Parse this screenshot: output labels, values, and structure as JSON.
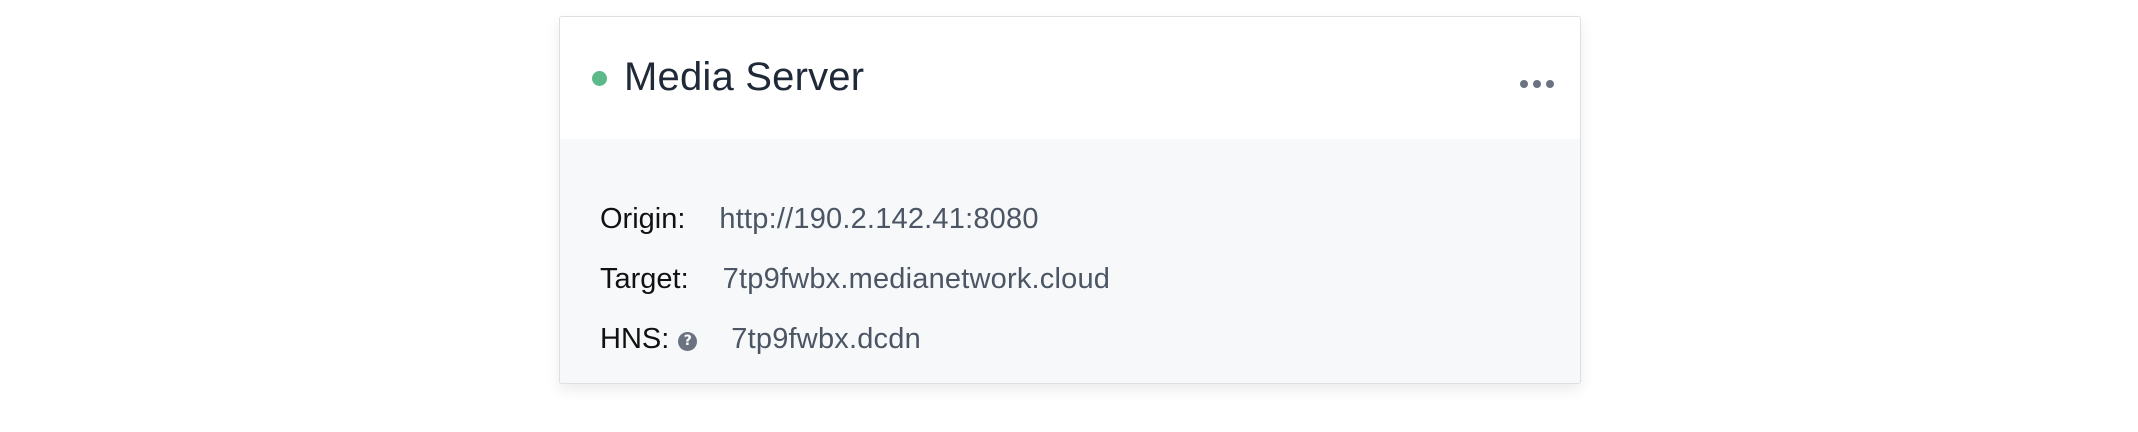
{
  "card": {
    "title": "Media Server",
    "status_color": "#5cb98a",
    "menu_icon": "ellipsis-icon"
  },
  "details": {
    "origin": {
      "label": "Origin:",
      "value": "http://190.2.142.41:8080"
    },
    "target": {
      "label": "Target:",
      "value": "7tp9fwbx.medianetwork.cloud"
    },
    "hns": {
      "label": "HNS:",
      "value": "7tp9fwbx.dcdn",
      "help_icon_glyph": "?"
    }
  }
}
